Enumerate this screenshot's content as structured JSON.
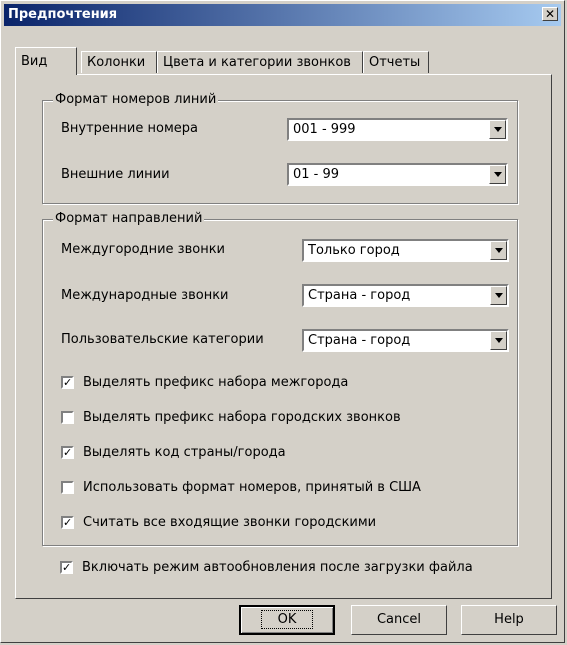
{
  "window": {
    "title": "Предпочтения",
    "close_glyph": "✕"
  },
  "tabs": [
    {
      "label": "Вид",
      "active": true
    },
    {
      "label": "Колонки",
      "active": false
    },
    {
      "label": "Цвета и категории звонков",
      "active": false
    },
    {
      "label": "Отчеты",
      "active": false
    }
  ],
  "line_format": {
    "legend": "Формат номеров линий",
    "internal": {
      "label": "Внутренние номера",
      "value": "001 - 999"
    },
    "external": {
      "label": "Внешние линии",
      "value": "01 - 99"
    }
  },
  "direction_format": {
    "legend": "Формат направлений",
    "intercity": {
      "label": "Междугородние звонки",
      "value": "Только город"
    },
    "international": {
      "label": "Международные звонки",
      "value": "Страна - город"
    },
    "user_categories": {
      "label": "Пользовательские категории",
      "value": "Страна - город"
    },
    "checks": [
      {
        "label": "Выделять префикс набора межгорода",
        "checked": true
      },
      {
        "label": "Выделять префикс набора городских звонков",
        "checked": false
      },
      {
        "label": "Выделять код страны/города",
        "checked": true
      },
      {
        "label": "Использовать формат номеров, принятый в США",
        "checked": false
      },
      {
        "label": "Считать все входящие звонки городскими",
        "checked": true
      }
    ]
  },
  "auto_update": {
    "label": "Включать режим автообновления после загрузки файла",
    "checked": true
  },
  "buttons": {
    "ok": "OK",
    "cancel": "Cancel",
    "help": "Help"
  },
  "check_glyph": "✓"
}
